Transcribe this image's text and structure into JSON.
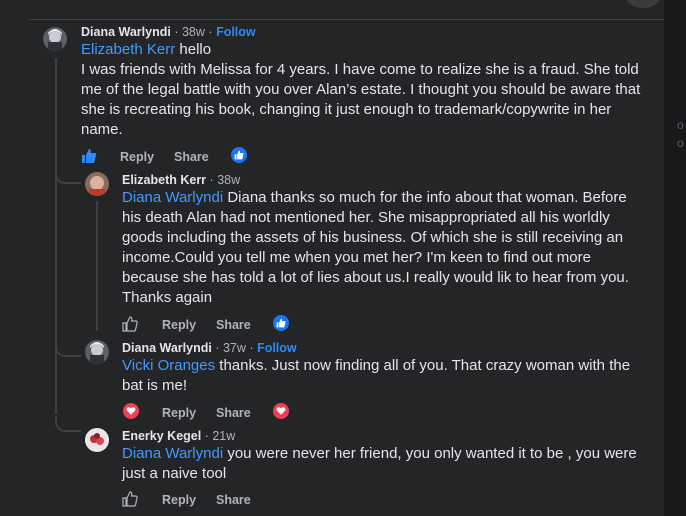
{
  "page": {
    "background_sidebar_texts": [
      "o",
      "o"
    ]
  },
  "colors": {
    "panel": "#242526",
    "mention": "#4599ff",
    "follow": "#2d88ff",
    "like": "#1877f2",
    "love": "#f33e58"
  },
  "comments": [
    {
      "author": "Diana Warlyndi",
      "time": "38w",
      "follow": "Follow",
      "mention": "Elizabeth Kerr",
      "text": " hello\nI was friends with Melissa for 4 years. I have come to realize she is a fraud. She told me of the legal battle with you over Alan’s estate. I thought you should be aware that she is recreating his book, changing it just enough to trademark/copywrite in her name.",
      "reply": "Reply",
      "share": "Share",
      "liked": true,
      "reaction_icon": "like-icon"
    },
    {
      "author": "Elizabeth Kerr",
      "time": "38w",
      "mention": "Diana Warlyndi",
      "text": " Diana thanks so much for the info about that woman. Before his death Alan had not mentioned her. She misappropriated all his worldly goods including the assets of his business. Of which she is still receiving an income.Could you tell me when you met her? I'm keen to find out more because she has told a lot of lies about us.I really would lik to hear from you. Thanks again",
      "reply": "Reply",
      "share": "Share",
      "liked": false,
      "reaction_icon": "like-icon"
    },
    {
      "author": "Diana Warlyndi",
      "time": "37w",
      "follow": "Follow",
      "mention": "Vicki Oranges",
      "text": " thanks. Just now finding all of you. That crazy woman with the bat is me!",
      "reply": "Reply",
      "share": "Share",
      "loved": true,
      "reaction_icon": "love-icon"
    },
    {
      "author": "Enerky Kegel",
      "time": "21w",
      "mention": "Diana Warlyndi",
      "text": " you were never her friend, you only wanted it to be , you were just a naive tool",
      "reply": "Reply",
      "share": "Share",
      "liked": false
    }
  ]
}
